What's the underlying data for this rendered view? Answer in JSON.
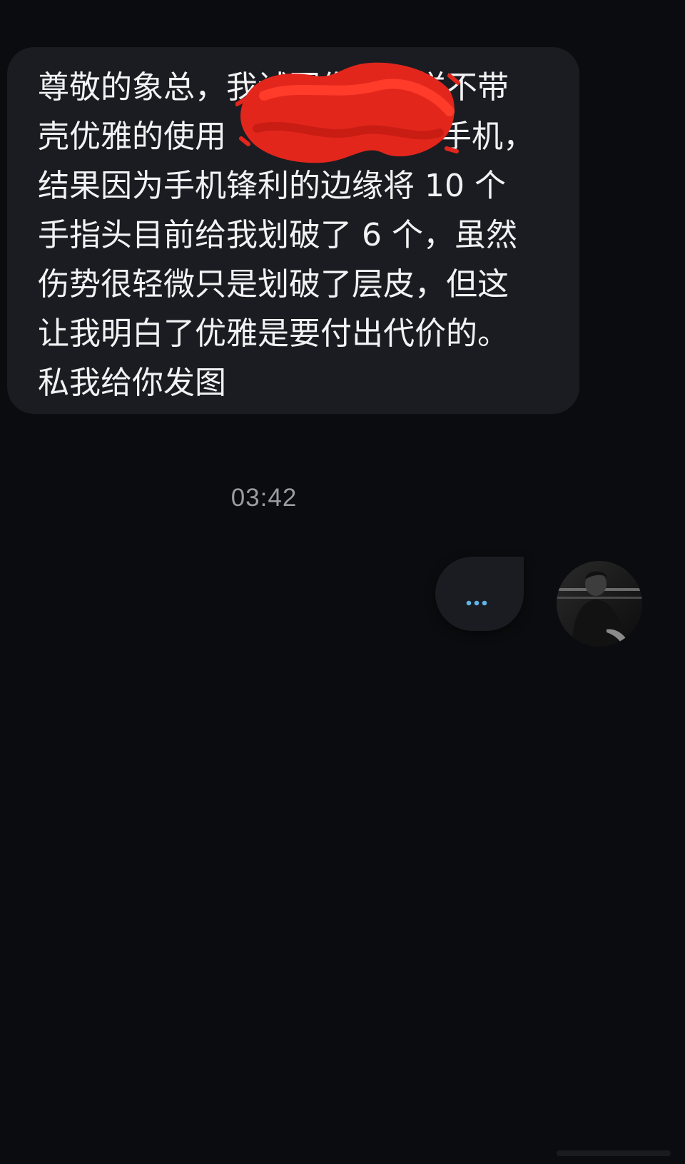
{
  "conversation": {
    "incoming_message": {
      "lines": [
        "尊敬的象总，我试图像您一样不带",
        "壳优雅的使用",
        "手机，",
        "结果因为手机锋利的边缘将 10 个",
        "手指头目前给我划破了 6 个，虽然",
        "伤势很轻微只是划破了层皮，但这",
        "让我明白了优雅是要付出代价的。",
        "私我给你发图"
      ]
    },
    "timestamp": "03:42",
    "outgoing_message": {
      "typing_indicator": "…"
    }
  },
  "colors": {
    "background": "#0b0c0f",
    "bubble": "#1b1c21",
    "text": "#f2f2f4",
    "timestamp": "#9a9ca3",
    "typing_dots": "#5fb3e6",
    "redaction": "#e3261c"
  },
  "icons": {
    "avatar": "user-avatar-photo",
    "redaction": "red-scribble-redaction"
  }
}
